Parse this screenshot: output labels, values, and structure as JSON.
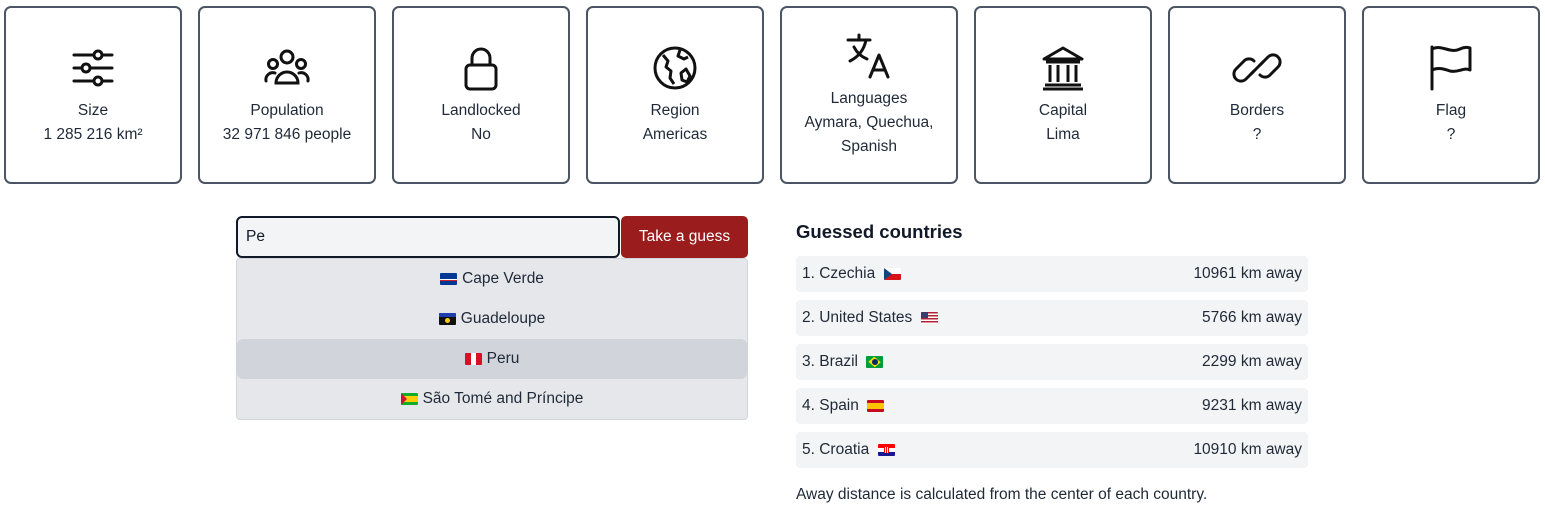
{
  "hints": [
    {
      "label": "Size",
      "value": "1 285 216 km²",
      "icon": "sliders-icon"
    },
    {
      "label": "Population",
      "value": "32 971 846 people",
      "icon": "people-icon"
    },
    {
      "label": "Landlocked",
      "value": "No",
      "icon": "lock-icon"
    },
    {
      "label": "Region",
      "value": "Americas",
      "icon": "globe-icon"
    },
    {
      "label": "Languages",
      "value": "Aymara, Quechua, Spanish",
      "icon": "translate-icon"
    },
    {
      "label": "Capital",
      "value": "Lima",
      "icon": "bank-icon"
    },
    {
      "label": "Borders",
      "value": "?",
      "icon": "link-icon"
    },
    {
      "label": "Flag",
      "value": "?",
      "icon": "flag-icon"
    }
  ],
  "search": {
    "value": "Pe",
    "button_label": "Take a guess",
    "suggestions": [
      {
        "name": "Cape Verde",
        "flag": "cape-verde-flag"
      },
      {
        "name": "Guadeloupe",
        "flag": "guadeloupe-flag"
      },
      {
        "name": "Peru",
        "flag": "peru-flag",
        "highlighted": true
      },
      {
        "name": "São Tomé and Príncipe",
        "flag": "sao-tome-flag"
      }
    ]
  },
  "guessed": {
    "title": "Guessed countries",
    "rows": [
      {
        "name": "1. Czechia",
        "flag": "czechia-flag",
        "distance": "10961 km away"
      },
      {
        "name": "2. United States",
        "flag": "us-flag",
        "distance": "5766 km away"
      },
      {
        "name": "3. Brazil",
        "flag": "brazil-flag",
        "distance": "2299 km away"
      },
      {
        "name": "4. Spain",
        "flag": "spain-flag",
        "distance": "9231 km away"
      },
      {
        "name": "5. Croatia",
        "flag": "croatia-flag",
        "distance": "10910 km away"
      }
    ]
  },
  "note": "Away distance is calculated from the center of each country.",
  "colors": {
    "accent": "#9b1c1c",
    "card_border": "#4b5563",
    "row_bg": "#f3f4f6",
    "dropdown_bg": "#e5e7eb"
  }
}
